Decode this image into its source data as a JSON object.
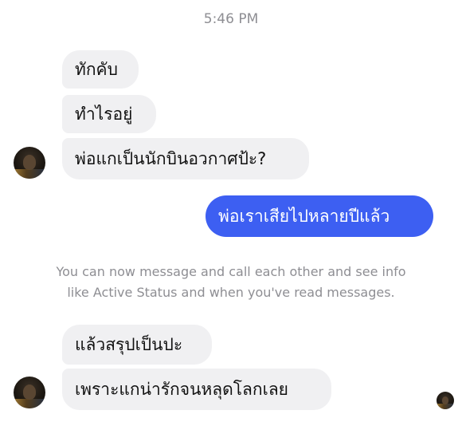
{
  "thread": {
    "timestamp": "5:46 PM",
    "messages": [
      {
        "text": "ทักคับ"
      },
      {
        "text": "ทำไรอยู่"
      },
      {
        "text": "พ่อแกเป็นนักบินอวกาศป้ะ?"
      },
      {
        "text": "พ่อเราเสียไปหลายปีแล้ว"
      },
      {
        "text": "แล้วสรุปเป็นปะ"
      },
      {
        "text": "เพราะแกน่ารักจนหลุดโลกเลย"
      }
    ],
    "notice_line1": "You can now message and call each other and see info",
    "notice_line2": "like Active Status and when you've read messages."
  },
  "colors": {
    "incoming_bubble": "#f0f0f2",
    "outgoing_bubble": "#3d5ff2",
    "meta_text": "#8e8e93"
  }
}
